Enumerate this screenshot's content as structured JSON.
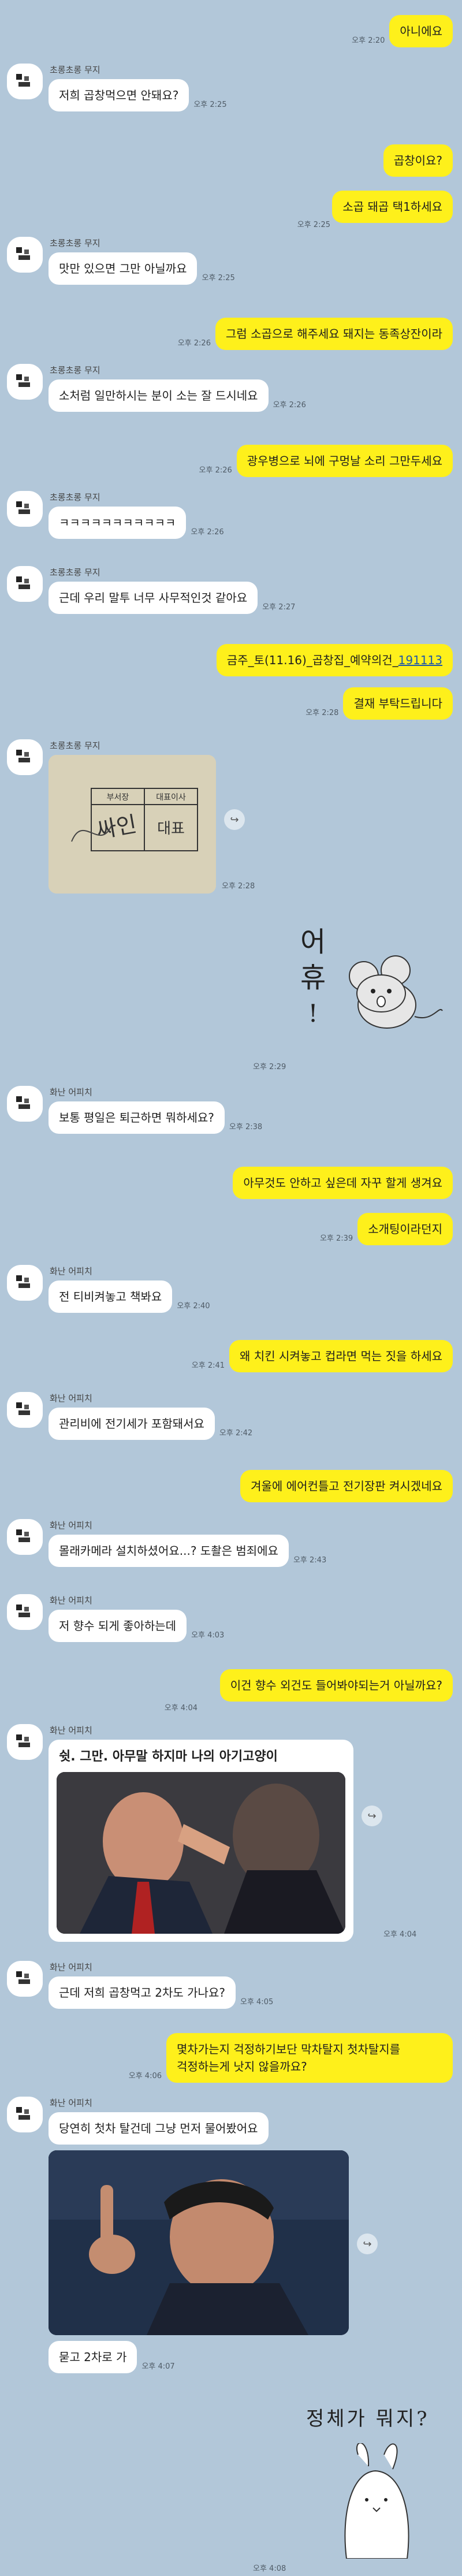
{
  "messages": [
    {
      "side": "right",
      "text": "아니에요",
      "time": "오후 2:20"
    },
    {
      "side": "left",
      "sender": "초롱초롱 무지",
      "text": "저희 곱창먹으면 안돼요?",
      "time": "오후 2:25"
    },
    {
      "side": "right",
      "text": "곱창이요?"
    },
    {
      "side": "right",
      "text": "소곱 돼곱 택1하세요",
      "time": "오후 2:25"
    },
    {
      "side": "left",
      "sender": "초롱초롱 무지",
      "text": "맛만 있으면 그만 아닐까요",
      "time": "오후 2:25"
    },
    {
      "side": "right",
      "text": "그럼 소곱으로 해주세요 돼지는 동족상잔이라",
      "time": "오후 2:26"
    },
    {
      "side": "left",
      "sender": "초롱초롱 무지",
      "text": "소처럼 일만하시는 분이 소는 잘 드시네요",
      "time": "오후 2:26"
    },
    {
      "side": "right",
      "text": "광우병으로 뇌에 구멍날 소리 그만두세요",
      "time": "오후 2:26"
    },
    {
      "side": "left",
      "sender": "초롱초롱 무지",
      "text": "ㅋㅋㅋㅋㅋㅋㅋㅋㅋㅋㅋ",
      "time": "오후 2:26"
    },
    {
      "side": "left",
      "sender": "초롱초롱 무지",
      "text": "근데 우리 말투 너무 사무적인것 같아요",
      "time": "오후 2:27"
    },
    {
      "side": "right",
      "text": "금주_토(11.16)_곱창집_예약의건_",
      "link": "191113"
    },
    {
      "side": "right",
      "text": "결재 부탁드립니다",
      "time": "오후 2:28"
    },
    {
      "side": "left",
      "sender": "초롱초롱 무지",
      "type": "approval-image",
      "stamp_headers": [
        "부서장",
        "대표이사"
      ],
      "sign_text": "싸인",
      "stamp_text": "대표",
      "time": "오후 2:28"
    },
    {
      "side": "sticker",
      "sticker": "mouse",
      "text_top": "어",
      "text_bottom": "휴",
      "time": "오후 2:29"
    },
    {
      "side": "left",
      "sender": "화난 어피치",
      "text": "보통 평일은 퇴근하면 뭐하세요?",
      "time": "오후 2:38"
    },
    {
      "side": "right",
      "text": "아무것도 안하고 싶은데 자꾸 할게 생겨요"
    },
    {
      "side": "right",
      "text": "소개팅이라던지",
      "time": "오후 2:39"
    },
    {
      "side": "left",
      "sender": "화난 어피치",
      "text": "전 티비켜놓고 책봐요",
      "time": "오후 2:40"
    },
    {
      "side": "right",
      "text": "왜 치킨 시켜놓고 컵라면 먹는 짓을 하세요",
      "time": "오후 2:41"
    },
    {
      "side": "left",
      "sender": "화난 어피치",
      "text": "관리비에 전기세가 포함돼서요",
      "time": "오후 2:42"
    },
    {
      "side": "right",
      "text": "겨울에 에어컨틀고 전기장판 켜시겠네요"
    },
    {
      "side": "left",
      "sender": "화난 어피치",
      "text": "몰래카메라 설치하셨어요...? 도촬은 범죄에요",
      "time": "오후 2:43"
    },
    {
      "side": "left",
      "sender": "화난 어피치",
      "text": "저 향수 되게 좋아하는데",
      "time": "오후 4:03"
    },
    {
      "side": "right",
      "text": "이건 향수 외건도 들어봐야되는거 아닐까요?",
      "time": "오후 4:04"
    },
    {
      "side": "left",
      "sender": "화난 어피치",
      "type": "meme",
      "caption": "쉿. 그만. 아무말 하지마 나의 아기고양이",
      "time": "오후 4:04"
    },
    {
      "side": "left",
      "sender": "화난 어피치",
      "text": "근데 저희 곱창먹고 2차도 가나요?",
      "time": "오후 4:05"
    },
    {
      "side": "right",
      "text": "몇차가는지 걱정하기보단 막차탈지 첫차탈지를 걱정하는게 낫지 않을까요?",
      "time": "오후 4:06"
    },
    {
      "side": "left",
      "sender": "화난 어피치",
      "text": "당연히 첫차 탈건데 그냥 먼저 물어봤어요",
      "image": "man-pointing",
      "follow": "묻고 2차로 가",
      "time": "오후 4:07"
    },
    {
      "side": "sticker2",
      "text": "정체가 뭐지?",
      "time": "오후 4:08"
    }
  ],
  "colors": {
    "background": "#b2c7d9",
    "me": "#fef01b",
    "them": "#ffffff"
  }
}
